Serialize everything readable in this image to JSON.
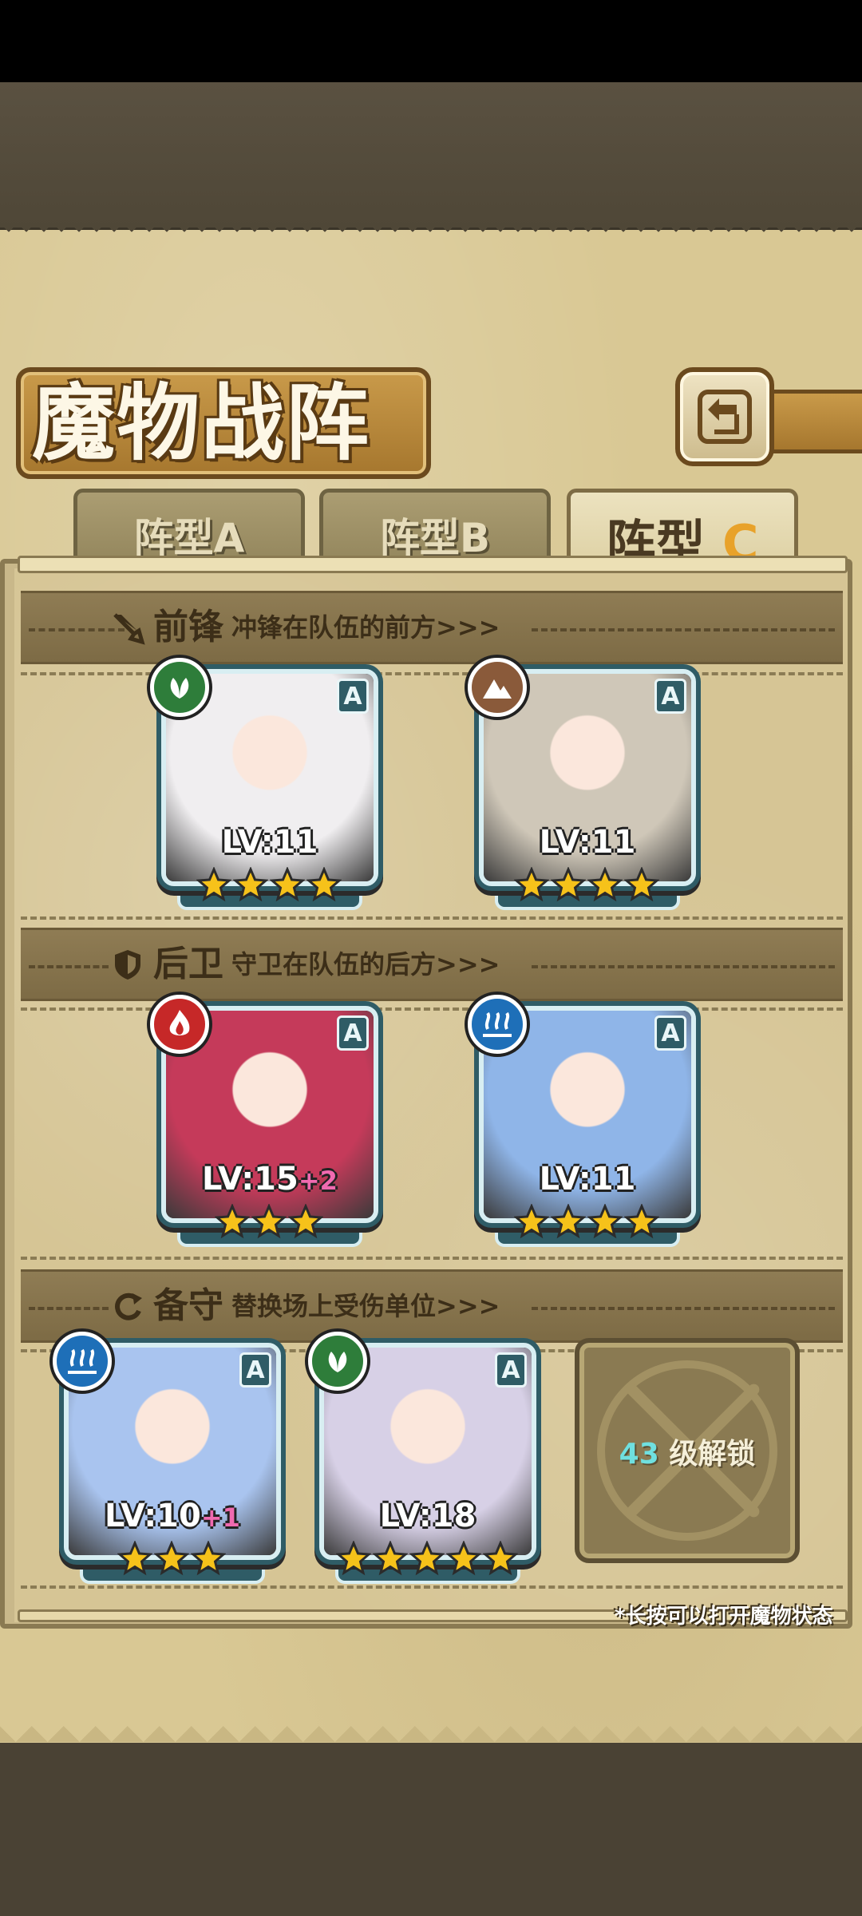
{
  "page": {
    "title": "魔物战阵",
    "back_button": "back-arrow-icon"
  },
  "tabs": [
    {
      "label": "阵型A",
      "active": false
    },
    {
      "label": "阵型B",
      "active": false
    },
    {
      "label_main": "阵型",
      "label_accent": "C",
      "active": true
    }
  ],
  "sections": {
    "front": {
      "title": "前锋",
      "subtitle": "冲锋在队伍的前方>>>",
      "icon": "sword-icon"
    },
    "rear": {
      "title": "后卫",
      "subtitle": "守卫在队伍的后方>>>",
      "icon": "shield-icon"
    },
    "reserve": {
      "title": "备守",
      "subtitle": "替换场上受伤单位>>>",
      "icon": "swap-icon"
    }
  },
  "monsters": [
    {
      "slot": "front-1",
      "level": "LV:11",
      "bonus": "",
      "stars": 4,
      "rank": "A",
      "element": "nature",
      "element_color": "#2e7d3a",
      "art_color": "#f0eef0"
    },
    {
      "slot": "front-2",
      "level": "LV:11",
      "bonus": "",
      "stars": 4,
      "rank": "A",
      "element": "earth",
      "element_color": "#8a5a3a",
      "art_color": "#cfc7b8"
    },
    {
      "slot": "rear-1",
      "level": "LV:15",
      "bonus": "+2",
      "stars": 3,
      "rank": "A",
      "element": "fire",
      "element_color": "#c62828",
      "art_color": "#c53a5a"
    },
    {
      "slot": "rear-2",
      "level": "LV:11",
      "bonus": "",
      "stars": 4,
      "rank": "A",
      "element": "water",
      "element_color": "#1e6fb8",
      "art_color": "#8fb5e8"
    },
    {
      "slot": "reserve-1",
      "level": "LV:10",
      "bonus": "+1",
      "stars": 3,
      "rank": "A",
      "element": "water",
      "element_color": "#1e6fb8",
      "art_color": "#a9c4ef"
    },
    {
      "slot": "reserve-2",
      "level": "LV:18",
      "bonus": "",
      "stars": 5,
      "rank": "A",
      "element": "nature",
      "element_color": "#2e7d3a",
      "art_color": "#d7d0e6"
    }
  ],
  "locked_slot": {
    "level": "43",
    "text": "级解锁"
  },
  "hint": "*长按可以打开魔物状态",
  "colors": {
    "parchment": "#d9c894",
    "card_border": "#d8eef2",
    "card_frame": "#2f5c66",
    "star": "#f6c21a",
    "tab_accent": "#e8a22a"
  }
}
